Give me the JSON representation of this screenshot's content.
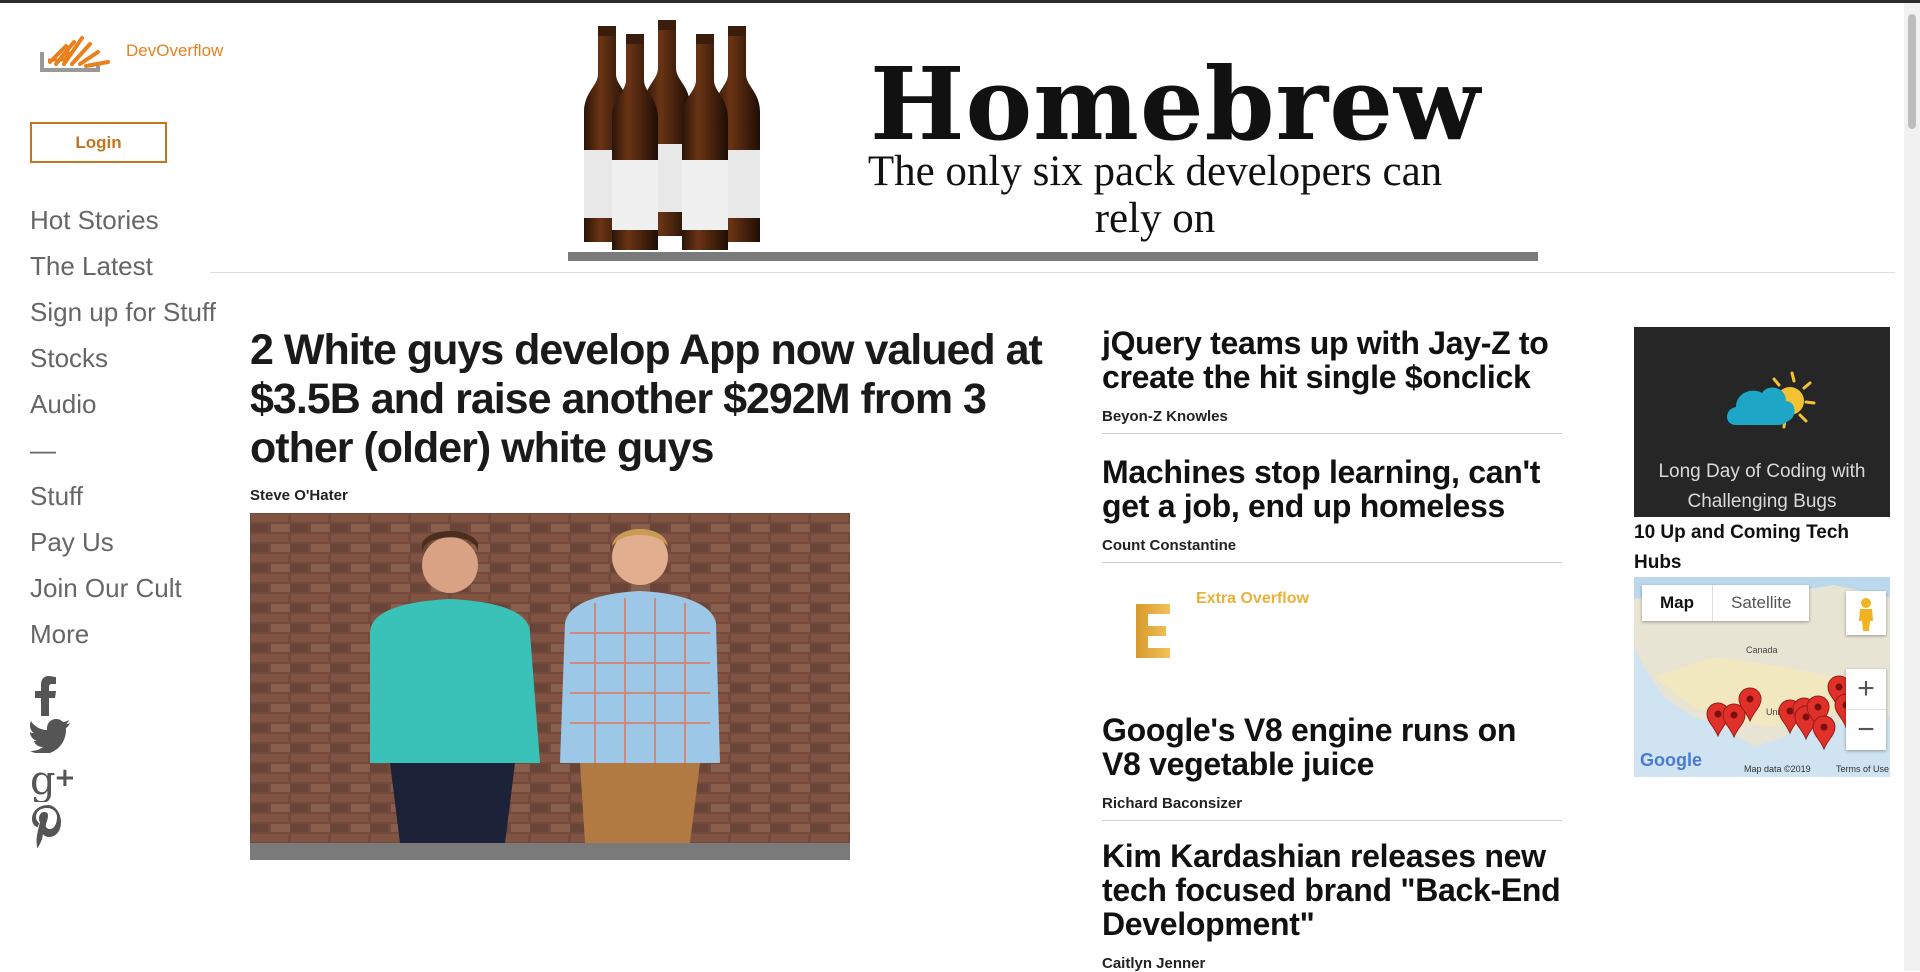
{
  "brand": {
    "name": "DevOverflow",
    "accent": "#e8811d"
  },
  "login_label": "Login",
  "nav": {
    "items": [
      "Hot Stories",
      "The Latest",
      "Sign up for Stuff",
      "Stocks",
      "Audio",
      "—",
      "Stuff",
      "Pay Us",
      "Join Our Cult",
      "More"
    ]
  },
  "social": [
    "facebook-icon",
    "twitter-icon",
    "google-plus-icon",
    "pinterest-icon"
  ],
  "banner": {
    "title": "Homebrew",
    "subtitle": "The only six pack developers can rely on"
  },
  "main_story": {
    "headline": "2 White guys develop App now valued at $3.5B and raise another $292M from 3 other (older) white guys",
    "author": "Steve O'Hater"
  },
  "stories": [
    {
      "headline": "jQuery teams up with Jay-Z to create the hit single $onclick",
      "author": "Beyon-Z Knowles"
    },
    {
      "headline": "Machines stop learning, can't get a job, end up homeless",
      "author": "Count Constantine"
    },
    {
      "headline": "Google's V8 engine runs on V8 vegetable juice",
      "author": "Richard Baconsizer"
    },
    {
      "headline": "Kim Kardashian releases new tech focused brand \"Back-End Development\"",
      "author": "Caitlyn Jenner"
    }
  ],
  "promo": {
    "label": "Extra Overflow",
    "color": "#e8b23a"
  },
  "weather_card": {
    "text": "Long Day of Coding with Challenging Bugs"
  },
  "hubs_title": "10 Up and Coming Tech Hubs",
  "map": {
    "tab_map": "Map",
    "tab_satellite": "Satellite",
    "zoom_in": "+",
    "zoom_out": "−",
    "label_canada": "Canada",
    "label_states": "United Sta",
    "google": "Google",
    "data": "Map data ©2019",
    "terms": "Terms of Use",
    "marker_count": 10
  }
}
